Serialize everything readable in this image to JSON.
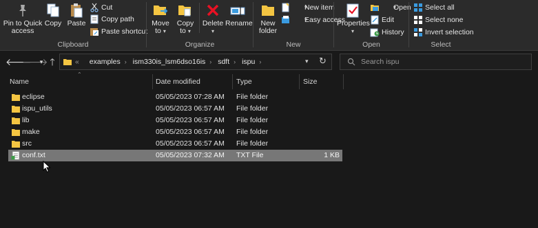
{
  "ribbon": {
    "clipboard": {
      "group_label": "Clipboard",
      "pin_label_1": "Pin to Quick",
      "pin_label_2": "access",
      "copy_label": "Copy",
      "paste_label": "Paste",
      "cut_label": "Cut",
      "copy_path_label": "Copy path",
      "paste_shortcut_label": "Paste shortcut"
    },
    "organize": {
      "group_label": "Organize",
      "move_label_1": "Move",
      "move_label_2": "to",
      "copy_label_1": "Copy",
      "copy_label_2": "to",
      "delete_label": "Delete",
      "rename_label": "Rename"
    },
    "new": {
      "group_label": "New",
      "new_folder_label_1": "New",
      "new_folder_label_2": "folder",
      "new_item_label": "New item",
      "easy_access_label": "Easy access"
    },
    "open": {
      "group_label": "Open",
      "properties_label": "Properties",
      "open_label": "Open",
      "edit_label": "Edit",
      "history_label": "History"
    },
    "select": {
      "group_label": "Select",
      "select_all_label": "Select all",
      "select_none_label": "Select none",
      "invert_label": "Invert selection"
    }
  },
  "address": {
    "overflow": "«",
    "crumbs": [
      "examples",
      "ism330is_lsm6dso16is",
      "sdft",
      "ispu"
    ]
  },
  "search": {
    "placeholder": "Search ispu"
  },
  "columns": {
    "name": "Name",
    "date": "Date modified",
    "type": "Type",
    "size": "Size"
  },
  "files": [
    {
      "name": "eclipse",
      "date": "05/05/2023 07:28 AM",
      "type": "File folder",
      "size": "",
      "icon": "folder-icon",
      "selected": false
    },
    {
      "name": "ispu_utils",
      "date": "05/05/2023 06:57 AM",
      "type": "File folder",
      "size": "",
      "icon": "folder-icon",
      "selected": false
    },
    {
      "name": "lib",
      "date": "05/05/2023 06:57 AM",
      "type": "File folder",
      "size": "",
      "icon": "folder-icon",
      "selected": false
    },
    {
      "name": "make",
      "date": "05/05/2023 06:57 AM",
      "type": "File folder",
      "size": "",
      "icon": "folder-icon",
      "selected": false
    },
    {
      "name": "src",
      "date": "05/05/2023 06:57 AM",
      "type": "File folder",
      "size": "",
      "icon": "folder-icon",
      "selected": false
    },
    {
      "name": "conf.txt",
      "date": "05/05/2023 07:32 AM",
      "type": "TXT File",
      "size": "1 KB",
      "icon": "text-file-icon",
      "selected": true
    }
  ],
  "colors": {
    "folder": "#f4c542",
    "selection": "#777777",
    "delete_red": "#e81123",
    "accent_blue": "#3a9be0"
  }
}
